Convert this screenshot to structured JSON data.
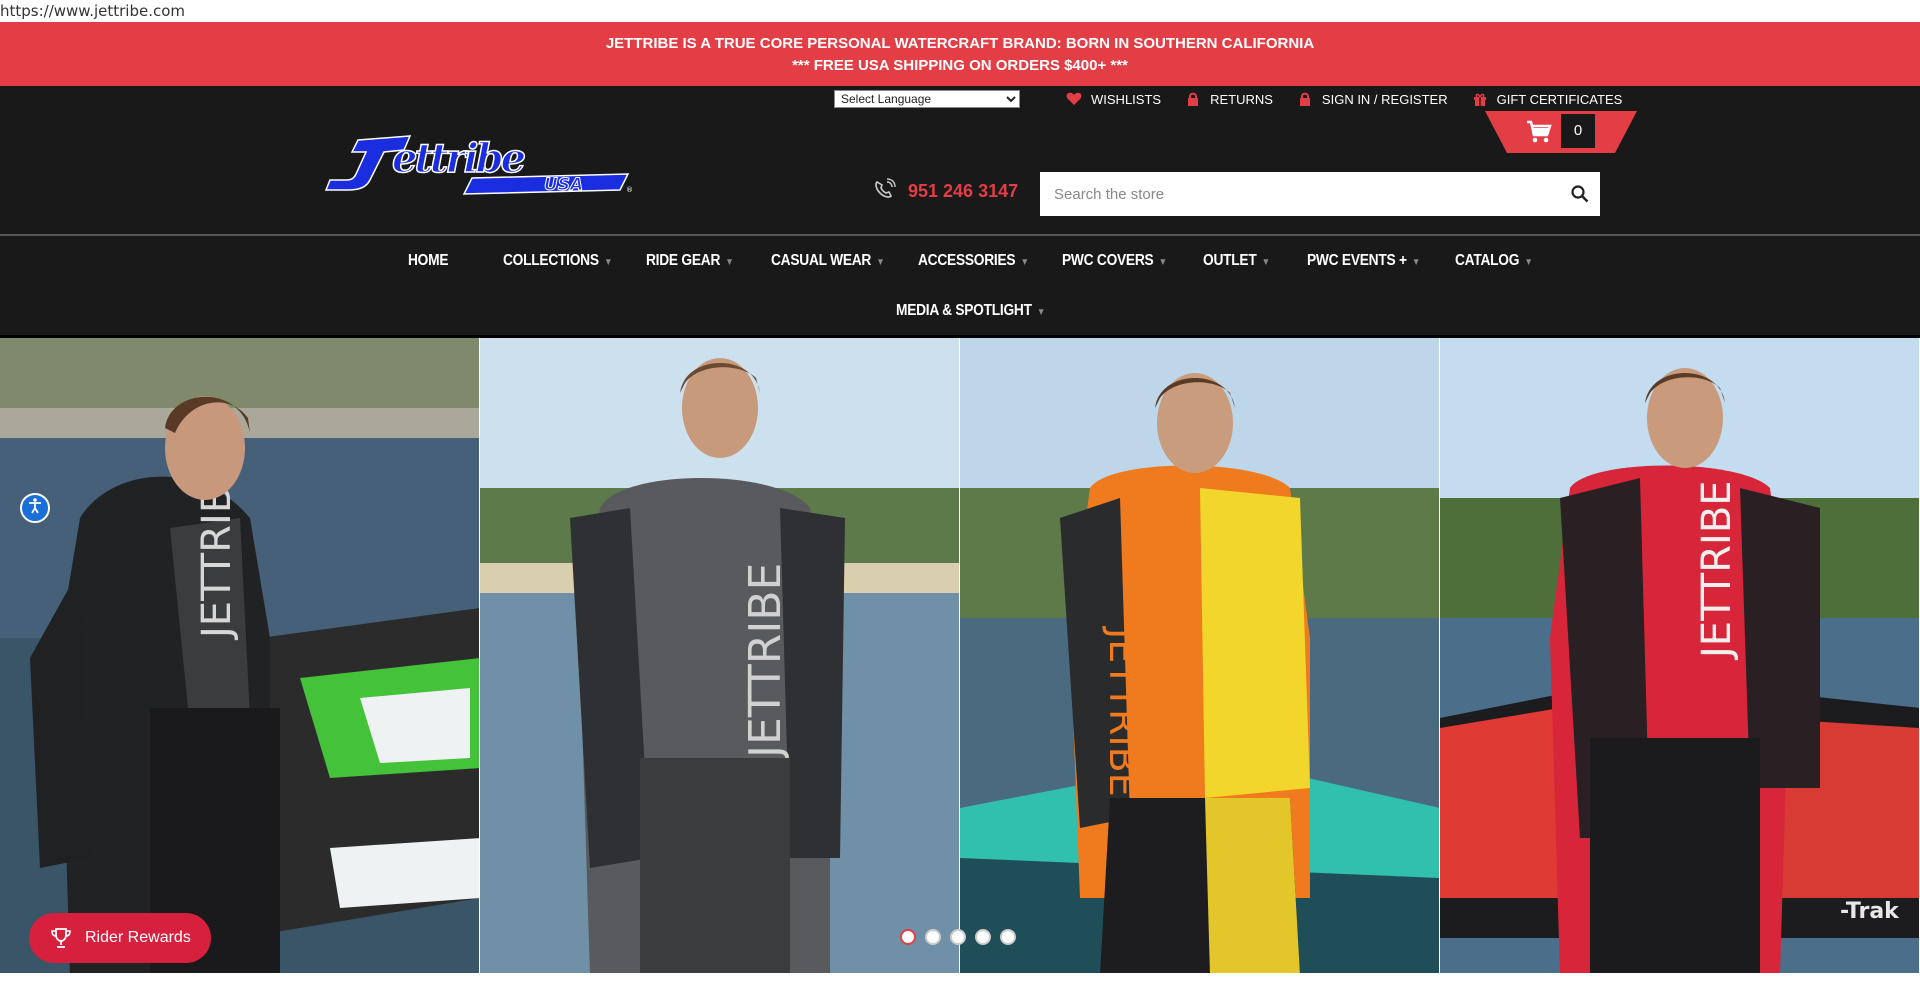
{
  "browser": {
    "url": "https://www.jettribe.com"
  },
  "promo": {
    "line1": "JETTRIBE IS A TRUE CORE PERSONAL WATERCRAFT BRAND:  BORN IN SOUTHERN CALIFORNIA",
    "line2": "*** FREE USA SHIPPING ON ORDERS $400+ ***"
  },
  "header": {
    "language_select": "Select Language",
    "links": [
      {
        "label": "WISHLISTS",
        "icon": "heart-icon"
      },
      {
        "label": "RETURNS",
        "icon": "lock-icon"
      },
      {
        "label": "SIGN IN / REGISTER",
        "icon": "lock-icon"
      },
      {
        "label": "GIFT CERTIFICATES",
        "icon": "gift-icon"
      }
    ],
    "cart_count": "0",
    "phone": "951 246 3147",
    "search_placeholder": "Search the store",
    "logo": "Jettribe USA"
  },
  "nav": {
    "items": [
      {
        "label": "HOME",
        "has_caret": false
      },
      {
        "label": "COLLECTIONS",
        "has_caret": true
      },
      {
        "label": "RIDE GEAR",
        "has_caret": true
      },
      {
        "label": "CASUAL WEAR",
        "has_caret": true
      },
      {
        "label": "ACCESSORIES",
        "has_caret": true
      },
      {
        "label": "PWC COVERS",
        "has_caret": true
      },
      {
        "label": "OUTLET",
        "has_caret": true
      },
      {
        "label": "PWC EVENTS +",
        "has_caret": true
      },
      {
        "label": "CATALOG",
        "has_caret": true
      },
      {
        "label": "MEDIA & SPOTLIGHT",
        "has_caret": true
      }
    ]
  },
  "hero": {
    "slides": [
      {
        "jacket": "black/white",
        "background": "green jetski"
      },
      {
        "jacket": "grey/black",
        "background": "beach"
      },
      {
        "jacket": "orange/yellow",
        "background": "teal jetski"
      },
      {
        "jacket": "red/black",
        "background": "red jetski"
      }
    ],
    "dots_total": 5,
    "dots_active": 1
  },
  "rewards": {
    "label": "Rider Rewards"
  },
  "colors": {
    "accent": "#e33d45",
    "header_bg": "#1a1919",
    "rewards_bg": "#d71f3e"
  }
}
